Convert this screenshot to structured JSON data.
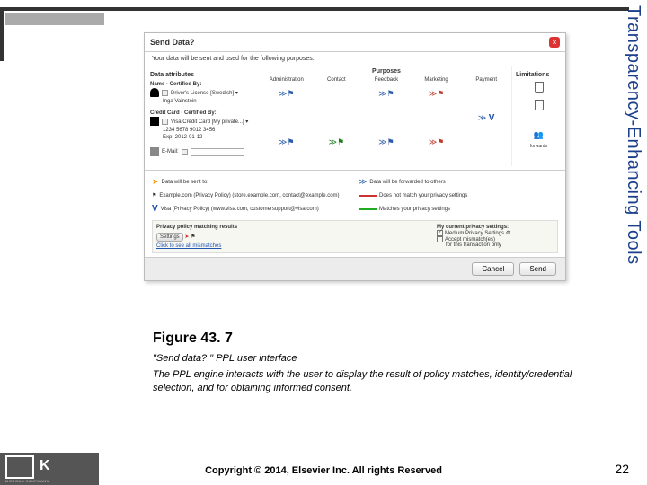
{
  "side_label": "Transparency-Enhancing Tools",
  "dialog": {
    "title": "Send Data?",
    "intro": "Your data will be sent and used for the following purposes:",
    "headers": {
      "attr": "Data attributes",
      "purposes": "Purposes",
      "limitations": "Limitations"
    },
    "purpose_cols": [
      "Administration",
      "Contact",
      "Feedback",
      "Marketing",
      "Payment"
    ],
    "attrs": {
      "name": {
        "title": "Name · Certified By:",
        "drivers": "Driver's License [Swedish] ▾",
        "value": "Inga Vainstein"
      },
      "cc": {
        "title": "Credit Card · Certified By:",
        "visa": "Visa Credit Card [My private...] ▾",
        "number": "1234 5678 9012 3456",
        "exp": "Exp: 2012-01-12"
      },
      "email": {
        "title": "E-Mail:",
        "placeholder": ""
      }
    },
    "sent": {
      "label": "Data will be sent to:",
      "forward_label": "Data will be forwarded to others",
      "example": "Example.com (Privacy Policy)  (store.example.com, contact@example.com)",
      "visa": "Visa (Privacy Policy)  (www.visa.com, customersupport@visa.com)",
      "legend_red": "Does not match your privacy settings",
      "legend_green": "Matches your privacy settings"
    },
    "policy": {
      "heading": "Privacy policy matching results",
      "settings": "Settings",
      "link": "Click to see all mismatches",
      "right_heading": "My current privacy settings:",
      "option_medium": "Medium Privacy Settings",
      "option_accept": "Accept mismatch(es)",
      "note": "for this transaction only"
    },
    "buttons": {
      "cancel": "Cancel",
      "send": "Send"
    }
  },
  "caption": {
    "title": "Figure 43. 7",
    "line1": "\"Send data? \" PPL user interface",
    "line2": "The PPL engine interacts with the user to display the result of policy matches, identity/credential selection, and for obtaining informed consent."
  },
  "footer": {
    "copyright": "Copyright © 2014, Elsevier Inc. All rights Reserved",
    "page": "22",
    "logo_letter": "K",
    "logo_sub": "MORGAN KAUFMANN"
  }
}
